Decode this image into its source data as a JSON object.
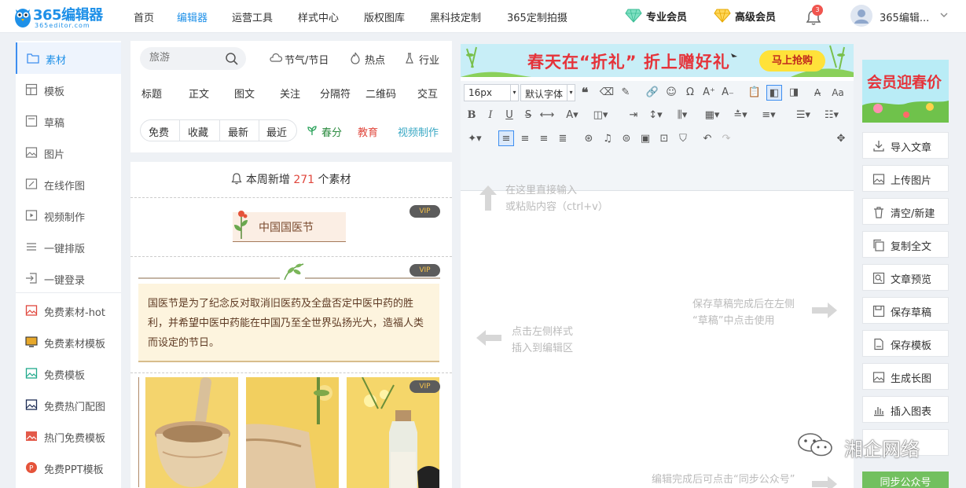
{
  "header": {
    "logo_text": "365编辑器",
    "logo_sub": "365editor.com",
    "nav": [
      {
        "label": "首页",
        "active": false
      },
      {
        "label": "编辑器",
        "active": true
      },
      {
        "label": "运营工具",
        "active": false
      },
      {
        "label": "样式中心",
        "active": false
      },
      {
        "label": "版权图库",
        "active": false
      },
      {
        "label": "黑科技定制",
        "active": false
      },
      {
        "label": "365定制拍摄",
        "active": false
      }
    ],
    "pro_member": "专业会员",
    "senior_member": "高级会员",
    "notification_count": "3",
    "username": "365编辑..."
  },
  "sidebar": {
    "items": [
      {
        "label": "素材",
        "icon": "folder-icon",
        "active": true
      },
      {
        "label": "模板",
        "icon": "layout-icon"
      },
      {
        "label": "草稿",
        "icon": "draft-icon"
      },
      {
        "label": "图片",
        "icon": "image-icon"
      },
      {
        "label": "在线作图",
        "icon": "draw-icon"
      },
      {
        "label": "视频制作",
        "icon": "video-icon"
      },
      {
        "label": "一键排版",
        "icon": "list-icon"
      },
      {
        "label": "一键登录",
        "icon": "login-icon"
      },
      {
        "label": "免费素材-hot",
        "icon": "image-red-icon"
      },
      {
        "label": "免费素材模板",
        "icon": "monitor-icon"
      },
      {
        "label": "免费模板",
        "icon": "image-green-icon"
      },
      {
        "label": "免费热门配图",
        "icon": "image-navy-icon"
      },
      {
        "label": "热门免费模板",
        "icon": "image-redfill-icon"
      },
      {
        "label": "免费PPT模板",
        "icon": "ppt-icon"
      }
    ]
  },
  "materials": {
    "search_placeholder": "旅游",
    "quick_tags": [
      "节气/节日",
      "热点",
      "行业"
    ],
    "categories": [
      "标题",
      "正文",
      "图文",
      "关注",
      "分隔符",
      "二维码",
      "交互"
    ],
    "filters": [
      "免费",
      "收藏",
      "最新",
      "最近"
    ],
    "tag_spring": "春分",
    "tag_edu": "教育",
    "tag_video": "视频制作",
    "notice_pre": "本周新增",
    "notice_count": "271",
    "notice_post": "个素材",
    "vip": "VIP",
    "card_title": "中国国医节",
    "card_para": "国医节是为了纪念反对取消旧医药及全盘否定中医中药的胜利，并希望中医中药能在中国乃至全世界弘扬光大，造福人类而设定的节日。"
  },
  "editor": {
    "banner_text": "春天在“折礼” 折上赠好礼",
    "banner_button": "马上抢购",
    "font_size": "16px",
    "font_family": "默认字体",
    "hint_input_1": "在这里直接输入",
    "hint_input_2": "或粘贴内容（ctrl+v）",
    "hint_left_1": "点击左侧样式",
    "hint_left_2": "插入到编辑区",
    "hint_right_1": "保存草稿完成后在左侧",
    "hint_right_2": "“草稿”中点击使用",
    "hint_bottom": "编辑完成后可点击“同步公众号”"
  },
  "right_panel": {
    "promo_text": "会员迎春价",
    "buttons": [
      {
        "label": "导入文章",
        "icon": "import-icon"
      },
      {
        "label": "上传图片",
        "icon": "upload-image-icon"
      },
      {
        "label": "清空/新建",
        "icon": "trash-icon"
      },
      {
        "label": "复制全文",
        "icon": "copy-icon"
      },
      {
        "label": "文章预览",
        "icon": "preview-icon"
      },
      {
        "label": "保存草稿",
        "icon": "save-icon"
      },
      {
        "label": "保存模板",
        "icon": "template-icon"
      },
      {
        "label": "生成长图",
        "icon": "long-image-icon"
      },
      {
        "label": "插入图表",
        "icon": "chart-icon"
      },
      {
        "label": "",
        "icon": "blank"
      }
    ],
    "sync_button": "同步公众号"
  },
  "watermark": "湘企网络"
}
